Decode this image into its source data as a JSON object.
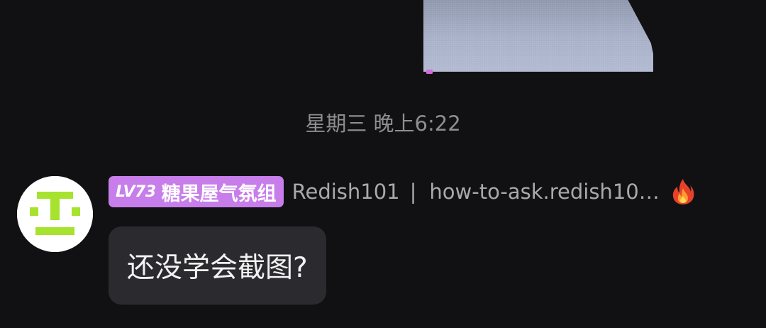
{
  "previous_message": {
    "image_alt": ""
  },
  "timestamp": "星期三 晚上6:22",
  "message": {
    "sender": {
      "avatar_icon": "pixel-face-avatar",
      "level": "LV73",
      "group": "糖果屋气氛组",
      "username": "Redish101",
      "separator": "|",
      "tagline": "how-to-ask.redish10…",
      "badge_icon": "fire-icon"
    },
    "text": "还没学会截图?"
  },
  "colors": {
    "background": "#111113",
    "level_badge": "#c77dea",
    "bubble": "#2b2b2f",
    "avatar_accent": "#a6e22e"
  }
}
